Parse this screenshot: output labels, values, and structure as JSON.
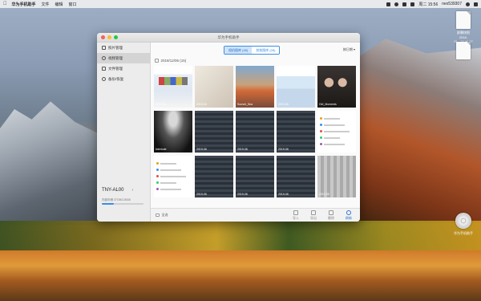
{
  "menubar": {
    "app_name": "华为手机助手",
    "items": [
      "文件",
      "编辑",
      "窗口"
    ],
    "time": "周二 15:56",
    "user": "nex539307"
  },
  "desktop": {
    "file1_label": "屏幕快照",
    "file1_sub": "2018-01...15.46.07",
    "disk_label": "华为手机助手"
  },
  "window": {
    "title": "华为手机助手",
    "sidebar": {
      "items": [
        {
          "label": "照片管理"
        },
        {
          "label": "视频管理"
        },
        {
          "label": "文件管理"
        },
        {
          "label": "备份/恢复"
        }
      ],
      "device_name": "TNY-AL00",
      "storage_text": "内部存储  37GB/128GB",
      "storage_fraction": 0.29
    },
    "segments": [
      "相机图库 (45)",
      "其他图库 (28)"
    ],
    "sort_label": "按日期 ▾",
    "date_header": "2018/12/06 (15)",
    "thumbs": [
      {
        "style": "th-shot",
        "caption": "2019-06"
      },
      {
        "style": "th-beige",
        "caption": "2019-06"
      },
      {
        "style": "th-sunset",
        "caption": "Sunset_Sea"
      },
      {
        "style": "th-screen2",
        "caption": "2019-06"
      },
      {
        "style": "th-girls",
        "caption": "Girl_Moments"
      },
      {
        "style": "th-concert",
        "caption": "Interlude"
      },
      {
        "style": "th-dark",
        "caption": "2019-06"
      },
      {
        "style": "th-dark",
        "caption": "2019-06"
      },
      {
        "style": "th-dark",
        "caption": "2019-06"
      },
      {
        "style": "th-list",
        "caption": ""
      },
      {
        "style": "th-list",
        "caption": ""
      },
      {
        "style": "th-dark",
        "caption": "2019-06"
      },
      {
        "style": "th-dark",
        "caption": "2019-06"
      },
      {
        "style": "th-dark",
        "caption": "2019-06"
      },
      {
        "style": "th-phone",
        "caption": "2019-06"
      }
    ],
    "select_all": "全选",
    "actions": [
      {
        "label": "导入",
        "primary": false
      },
      {
        "label": "导出",
        "primary": false
      },
      {
        "label": "删除",
        "primary": false
      },
      {
        "label": "刷新",
        "primary": true
      }
    ]
  }
}
